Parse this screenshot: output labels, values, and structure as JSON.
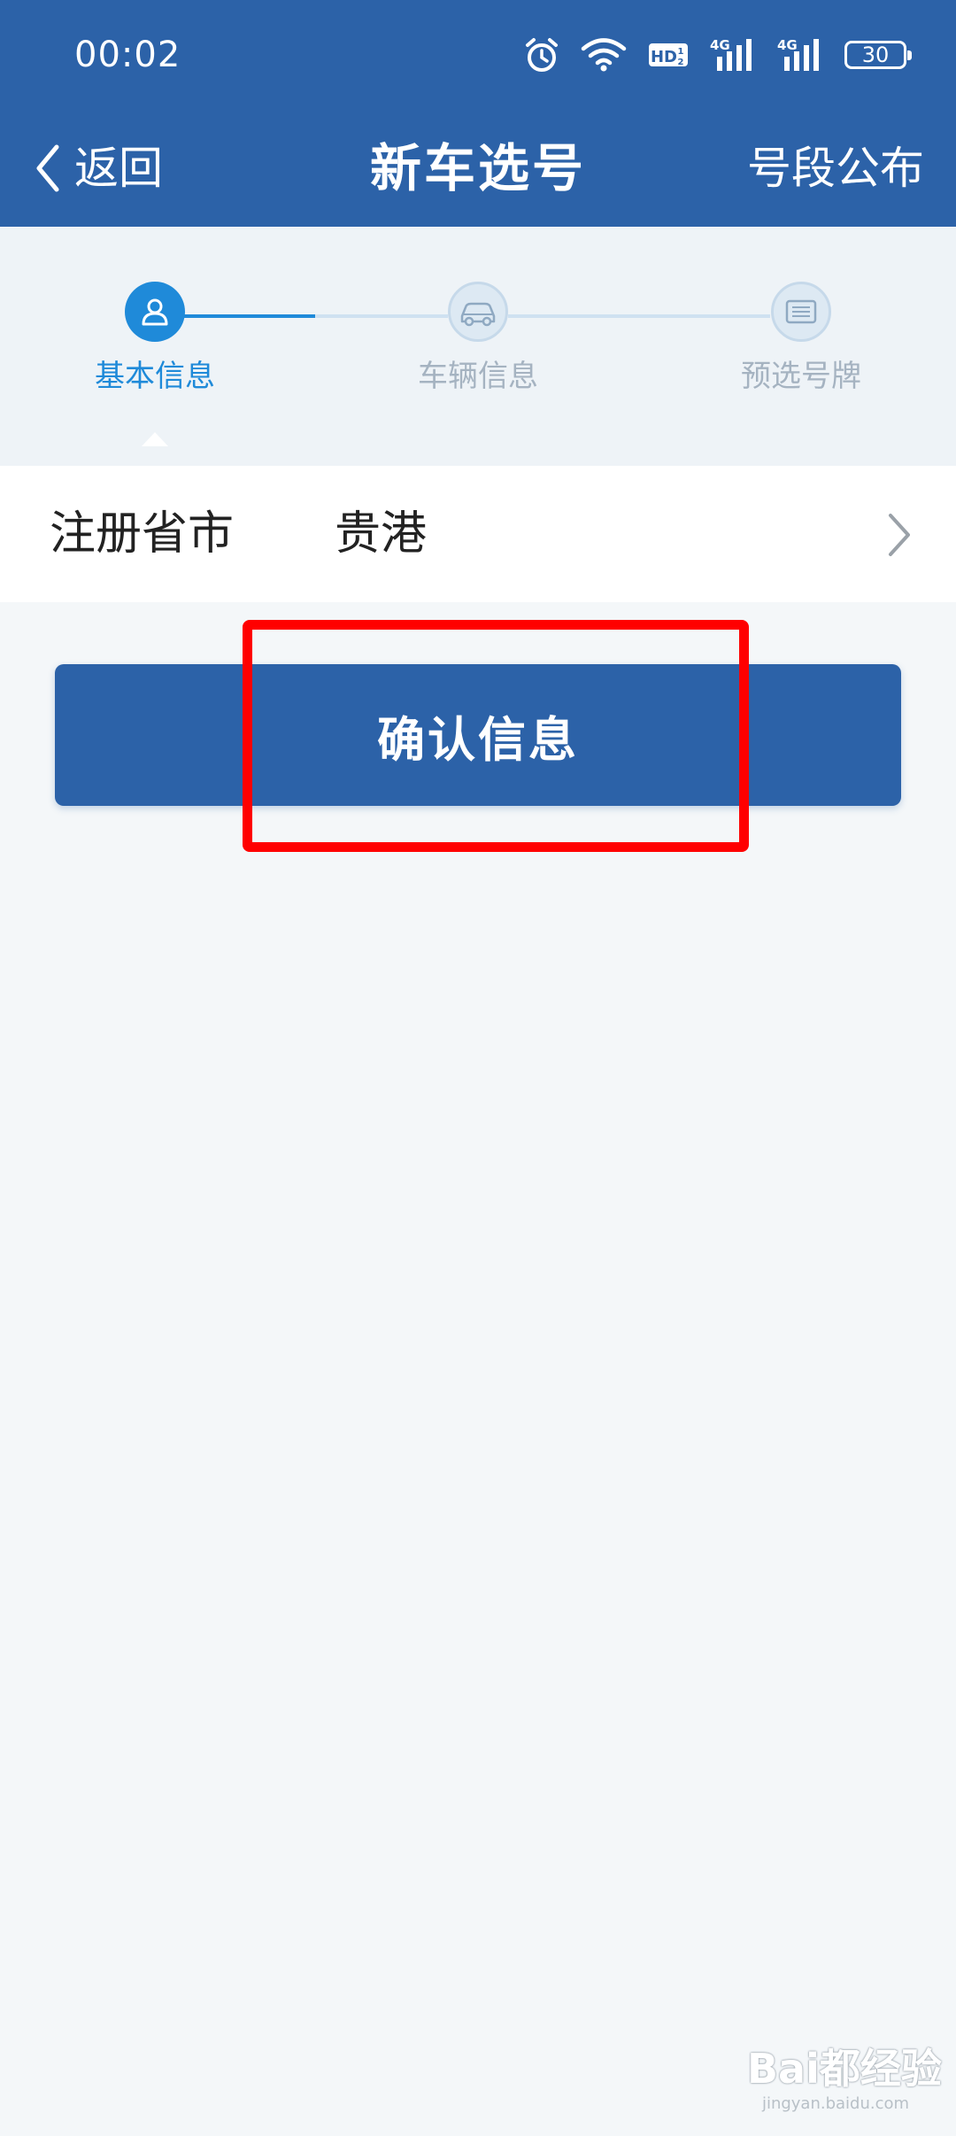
{
  "status_bar": {
    "time": "00:02",
    "hd_label": "HD",
    "network_label_1": "4G",
    "network_label_2": "4G",
    "battery_level": "30"
  },
  "header": {
    "back_label": "返回",
    "title": "新车选号",
    "action_label": "号段公布"
  },
  "steps": {
    "items": [
      {
        "label": "基本信息",
        "icon": "person-icon",
        "state": "active"
      },
      {
        "label": "车辆信息",
        "icon": "car-icon",
        "state": "inactive"
      },
      {
        "label": "预选号牌",
        "icon": "license-plate-icon",
        "state": "inactive"
      }
    ]
  },
  "form": {
    "province_label": "注册省市",
    "province_value": "贵港"
  },
  "confirm_button": {
    "label": "确认信息"
  },
  "watermark": {
    "logo": "Bai都经验",
    "url": "jingyan.baidu.com"
  },
  "colors": {
    "header_bg": "#2c62a8",
    "step_active": "#1f8ad9",
    "step_inactive": "#a5b3c1",
    "page_bg": "#f4f7f9",
    "highlight": "#ff0000"
  }
}
